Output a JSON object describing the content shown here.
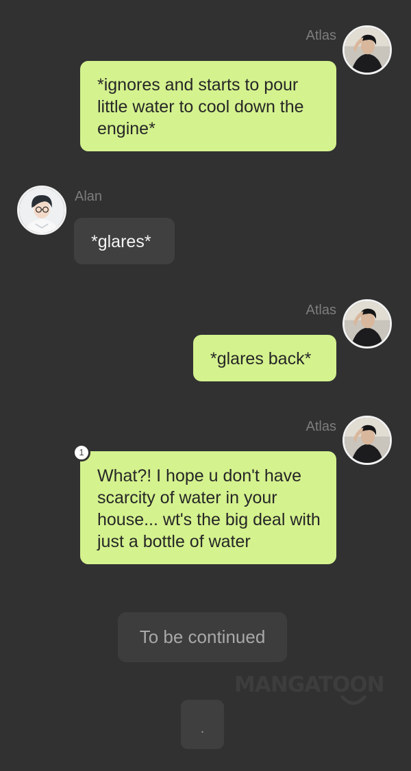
{
  "messages": [
    {
      "sender": "Atlas",
      "side": "right",
      "text": "*ignores and starts to pour little water to cool down the engine*"
    },
    {
      "sender": "Alan",
      "side": "left",
      "text": "*glares*"
    },
    {
      "sender": "Atlas",
      "side": "right",
      "text": "*glares back*"
    },
    {
      "sender": "Atlas",
      "side": "right",
      "text": "What?! I hope u don't have scarcity of water in your house... wt's the big deal with just a bottle of water",
      "comment_count": "1"
    }
  ],
  "continue_label": "To be continued",
  "watermark": "MANGATOON",
  "next_button_label": ".",
  "colors": {
    "background": "#313131",
    "own_bubble": "#d4f28e",
    "other_bubble": "#404040",
    "name_text": "#7d7d7d"
  },
  "icons": {
    "atlas_avatar": "avatar-atlas-icon",
    "alan_avatar": "avatar-alan-icon"
  }
}
